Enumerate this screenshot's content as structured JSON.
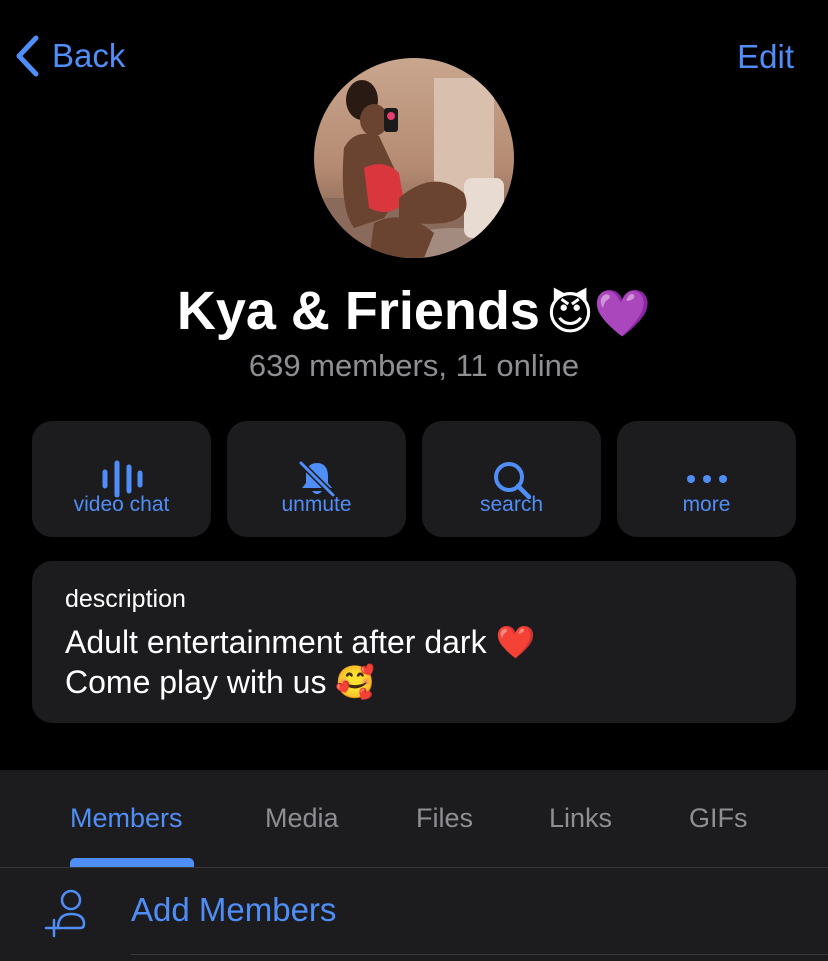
{
  "nav": {
    "back_label": "Back",
    "edit_label": "Edit"
  },
  "profile": {
    "title": "Kya & Friends",
    "title_emojis": "😈💜",
    "subtitle": "639 members, 11 online",
    "avatar": "avatar-photo"
  },
  "actions": [
    {
      "label": "video chat",
      "icon": "video-chat-waveform-icon"
    },
    {
      "label": "unmute",
      "icon": "bell-slash-icon"
    },
    {
      "label": "search",
      "icon": "search-icon"
    },
    {
      "label": "more",
      "icon": "ellipsis-icon"
    }
  ],
  "description": {
    "label": "description",
    "line1": "Adult entertainment after dark",
    "line1_emoji": "❤️",
    "line2": "Come play with us",
    "line2_emoji": "🥰"
  },
  "tabs": [
    {
      "label": "Members",
      "active": true
    },
    {
      "label": "Media",
      "active": false
    },
    {
      "label": "Files",
      "active": false
    },
    {
      "label": "Links",
      "active": false
    },
    {
      "label": "GIFs",
      "active": false
    }
  ],
  "add_members": {
    "label": "Add Members",
    "icon": "add-member-icon"
  },
  "colors": {
    "accent": "#4f8ef7",
    "card": "#1c1c1e",
    "secondary_text": "#8e8e93",
    "background": "#000000"
  }
}
